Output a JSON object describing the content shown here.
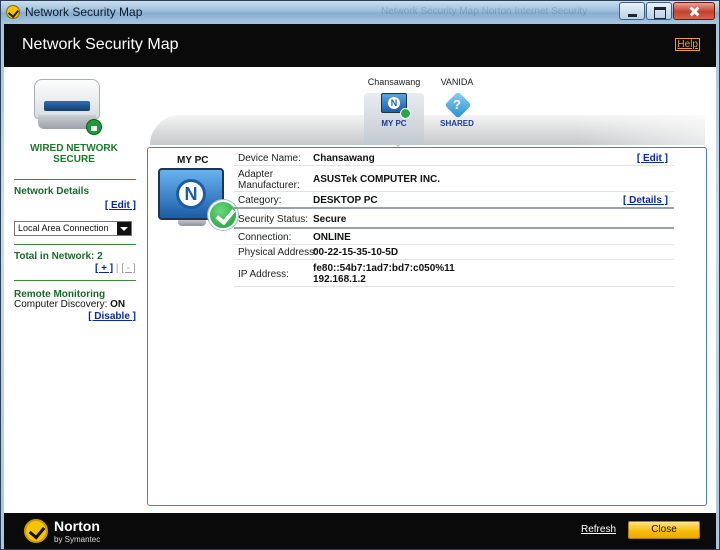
{
  "window": {
    "title": "Network Security Map",
    "faded_title_text": "Network Security Map Norton Internet Security"
  },
  "header": {
    "title": "Network Security Map",
    "help": "Help"
  },
  "left": {
    "network_status": "WIRED NETWORK SECURE",
    "network_details": {
      "title": "Network Details",
      "edit": "[ Edit ]"
    },
    "connection_select": {
      "value": "Local Area Connection"
    },
    "total": {
      "label": "Total in Network:",
      "count": "2",
      "add": "[ + ]",
      "sep": "|",
      "remove": "[ - ]"
    },
    "remote": {
      "title": "Remote Monitoring",
      "discovery_label": "Computer Discovery:",
      "discovery_value": "ON",
      "disable": "[ Disable ]"
    }
  },
  "nodes": [
    {
      "label": "Chansawang",
      "caption": "MY PC",
      "icon": "monitor-check-icon",
      "selected": true
    },
    {
      "label": "VANIDA",
      "caption": "SHARED",
      "icon": "shared-cube-icon",
      "selected": false
    }
  ],
  "panel": {
    "header": "MY PC",
    "rows": [
      {
        "key": "Device Name:",
        "value": "Chansawang",
        "action": "[ Edit ]"
      },
      {
        "key": "Adapter Manufacturer:",
        "value": "ASUSTek COMPUTER INC.",
        "action": ""
      },
      {
        "key": "Category:",
        "value": "DESKTOP PC",
        "action": "[ Details ]"
      },
      {
        "key": "Security Status:",
        "value": "Secure",
        "action": ""
      },
      {
        "key": "Connection:",
        "value": "ONLINE",
        "action": ""
      },
      {
        "key": "Physical Address:",
        "value": "00-22-15-35-10-5D",
        "action": ""
      },
      {
        "key": "IP Address:",
        "value": "fe80::54b7:1ad7:bd7:c050%11",
        "value2": "192.168.1.2",
        "action": ""
      }
    ]
  },
  "footer": {
    "brand": "Norton",
    "brand_sub": "by Symantec",
    "refresh": "Refresh",
    "close": "Close"
  },
  "colors": {
    "header_bg": "#0a0a0a",
    "accent_green": "#1a7a2a",
    "link_blue": "#0a2a9c",
    "help_orange": "#f0a020",
    "close_button": "#f7b900"
  }
}
